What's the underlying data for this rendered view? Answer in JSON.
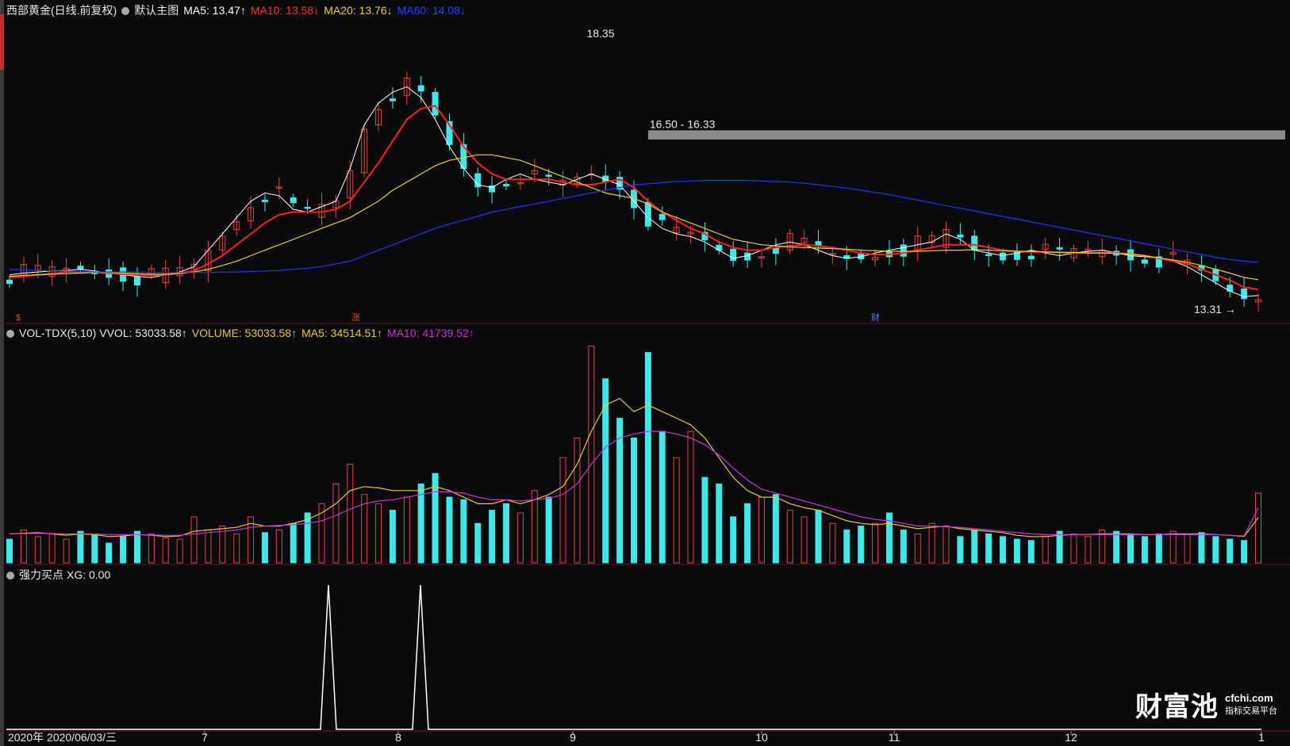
{
  "main_panel": {
    "stock": "西部黄金(日线.前复权)",
    "template": "默认主图",
    "ma5": "MA5: 13.47↑",
    "ma10": "MA10: 13.58↓",
    "ma20": "MA20: 13.76↓",
    "ma60": "MA60: 14.08↓",
    "high_label": "18.35",
    "zone_label": "16.50 - 16.33",
    "low_label": "13.31",
    "markers": [
      "$",
      "涨",
      "财"
    ]
  },
  "volume_panel": {
    "name": "VOL-TDX(5,10)",
    "vvol": "VVOL: 53033.58↑",
    "volume": "VOLUME: 53033.58↑",
    "ma5": "MA5: 34514.51↑",
    "ma10": "MA10: 41739.52↑"
  },
  "signal_panel": {
    "name": "强力买点",
    "xg": "XG: 0.00"
  },
  "footer": {
    "start": "2020年 2020/06/03/三",
    "months": [
      "7",
      "8",
      "9",
      "10",
      "11",
      "12",
      "1"
    ]
  },
  "logo": {
    "main": "财富池",
    "url": "cfchi.com",
    "tagline": "指标交易平台"
  },
  "colors": {
    "up": "#e0463c",
    "down": "#3ee8e8",
    "ma5": "#ffffff",
    "ma10": "#ff2020",
    "ma20": "#e8d030",
    "ma60": "#2233ee",
    "vol_ma5": "#e8c830",
    "vol_ma10": "#cc33cc",
    "signal": "#ffffff",
    "zone": "#8a8a8a"
  },
  "chart_data": [
    {
      "type": "candlestick",
      "title": "西部黄金(日线.前复权)",
      "x_range": [
        "2020-06-03",
        "2021-01"
      ],
      "ylim": [
        13.0,
        18.6
      ],
      "key_prices": {
        "high": 18.35,
        "low": 13.31,
        "zone": [
          16.33,
          16.5
        ]
      },
      "series": [
        {
          "name": "MA5",
          "values": [
            13.85,
            13.88,
            13.9,
            13.92,
            13.93,
            13.95,
            13.92,
            13.88,
            13.85,
            13.82,
            13.8,
            13.85,
            13.9,
            14.0,
            14.3,
            14.6,
            14.9,
            15.2,
            15.35,
            15.3,
            15.05,
            15.0,
            15.1,
            15.2,
            15.8,
            16.6,
            17.0,
            17.2,
            17.3,
            17.1,
            16.7,
            16.2,
            15.8,
            15.5,
            15.45,
            15.6,
            15.7,
            15.6,
            15.55,
            15.5,
            15.6,
            15.7,
            15.6,
            15.5,
            15.2,
            14.9,
            14.7,
            14.6,
            14.55,
            14.45,
            14.3,
            14.15,
            14.2,
            14.3,
            14.4,
            14.45,
            14.4,
            14.3,
            14.2,
            14.15,
            14.18,
            14.25,
            14.3,
            14.35,
            14.4,
            14.45,
            14.6,
            14.5,
            14.3,
            14.25,
            14.2,
            14.25,
            14.3,
            14.25,
            14.2,
            14.25,
            14.28,
            14.3,
            14.25,
            14.2,
            14.18,
            14.15,
            14.1,
            14.0,
            13.85,
            13.7,
            13.55,
            13.45,
            13.47
          ]
        },
        {
          "name": "MA10",
          "values": [
            13.8,
            13.82,
            13.85,
            13.87,
            13.9,
            13.9,
            13.9,
            13.88,
            13.86,
            13.85,
            13.84,
            13.85,
            13.88,
            13.92,
            14.05,
            14.2,
            14.4,
            14.6,
            14.8,
            14.95,
            15.0,
            15.0,
            15.0,
            15.05,
            15.2,
            15.55,
            15.9,
            16.3,
            16.7,
            16.9,
            16.95,
            16.6,
            16.2,
            15.9,
            15.7,
            15.6,
            15.6,
            15.6,
            15.6,
            15.55,
            15.5,
            15.5,
            15.55,
            15.6,
            15.45,
            15.2,
            15.0,
            14.85,
            14.7,
            14.6,
            14.45,
            14.35,
            14.3,
            14.3,
            14.35,
            14.38,
            14.4,
            14.38,
            14.35,
            14.3,
            14.25,
            14.22,
            14.22,
            14.25,
            14.3,
            14.35,
            14.4,
            14.4,
            14.4,
            14.35,
            14.3,
            14.28,
            14.27,
            14.27,
            14.26,
            14.25,
            14.25,
            14.25,
            14.25,
            14.23,
            14.2,
            14.15,
            14.1,
            14.05,
            13.95,
            13.85,
            13.75,
            13.62,
            13.58
          ]
        },
        {
          "name": "MA20",
          "values": [
            13.82,
            13.84,
            13.85,
            13.86,
            13.87,
            13.88,
            13.89,
            13.89,
            13.88,
            13.87,
            13.86,
            13.86,
            13.87,
            13.9,
            13.95,
            14.02,
            14.1,
            14.2,
            14.3,
            14.4,
            14.5,
            14.6,
            14.7,
            14.8,
            14.9,
            15.05,
            15.2,
            15.4,
            15.55,
            15.7,
            15.85,
            15.95,
            16.0,
            16.05,
            16.05,
            16.0,
            15.95,
            15.85,
            15.75,
            15.65,
            15.55,
            15.45,
            15.35,
            15.3,
            15.25,
            15.15,
            15.0,
            14.9,
            14.8,
            14.7,
            14.6,
            14.5,
            14.45,
            14.4,
            14.38,
            14.36,
            14.35,
            14.34,
            14.33,
            14.32,
            14.3,
            14.29,
            14.28,
            14.28,
            14.28,
            14.29,
            14.3,
            14.3,
            14.31,
            14.3,
            14.29,
            14.28,
            14.28,
            14.27,
            14.26,
            14.26,
            14.25,
            14.25,
            14.24,
            14.23,
            14.2,
            14.16,
            14.12,
            14.08,
            14.02,
            13.95,
            13.88,
            13.8,
            13.76
          ]
        },
        {
          "name": "MA60",
          "values": [
            13.95,
            13.94,
            13.93,
            13.92,
            13.92,
            13.91,
            13.9,
            13.9,
            13.9,
            13.9,
            13.89,
            13.89,
            13.89,
            13.89,
            13.89,
            13.9,
            13.9,
            13.91,
            13.92,
            13.93,
            13.95,
            13.97,
            14.0,
            14.05,
            14.1,
            14.2,
            14.3,
            14.4,
            14.5,
            14.6,
            14.7,
            14.78,
            14.85,
            14.92,
            15.0,
            15.05,
            15.1,
            15.15,
            15.2,
            15.25,
            15.3,
            15.35,
            15.4,
            15.45,
            15.5,
            15.52,
            15.54,
            15.56,
            15.57,
            15.58,
            15.58,
            15.58,
            15.58,
            15.57,
            15.56,
            15.55,
            15.53,
            15.5,
            15.47,
            15.44,
            15.4,
            15.36,
            15.32,
            15.27,
            15.22,
            15.17,
            15.12,
            15.07,
            15.02,
            14.97,
            14.92,
            14.87,
            14.82,
            14.77,
            14.72,
            14.67,
            14.62,
            14.57,
            14.52,
            14.47,
            14.42,
            14.37,
            14.32,
            14.27,
            14.22,
            14.17,
            14.13,
            14.1,
            14.08
          ]
        }
      ]
    },
    {
      "type": "bar",
      "title": "VOL-TDX(5,10)",
      "ylim": [
        0,
        170000
      ],
      "last": {
        "volume": 53033.58,
        "ma5": 34514.51,
        "ma10": 41739.52
      },
      "values": [
        18000,
        25000,
        20000,
        22000,
        18000,
        24000,
        21000,
        15000,
        20000,
        24000,
        22000,
        19000,
        18000,
        35000,
        25000,
        28000,
        22000,
        35000,
        23000,
        25000,
        30000,
        38000,
        45000,
        60000,
        75000,
        52000,
        45000,
        40000,
        50000,
        60000,
        68000,
        50000,
        48000,
        30000,
        40000,
        45000,
        38000,
        55000,
        50000,
        80000,
        95000,
        165000,
        140000,
        110000,
        95000,
        160000,
        100000,
        80000,
        100000,
        65000,
        60000,
        35000,
        45000,
        50000,
        52000,
        40000,
        35000,
        40000,
        30000,
        25000,
        28000,
        30000,
        38000,
        25000,
        22000,
        30000,
        28000,
        20000,
        25000,
        22000,
        20000,
        18000,
        17000,
        20000,
        24000,
        22000,
        20000,
        25000,
        24000,
        21000,
        20000,
        22000,
        24000,
        22000,
        23000,
        20000,
        18000,
        17000,
        53034
      ],
      "series": [
        {
          "name": "MA5",
          "values": [
            22000,
            22500,
            23000,
            22000,
            21000,
            22000,
            21500,
            20000,
            20500,
            21500,
            21000,
            20000,
            20500,
            24000,
            25000,
            26000,
            27000,
            30000,
            28000,
            28000,
            30000,
            33000,
            38000,
            45000,
            55000,
            58000,
            57000,
            55000,
            55000,
            55000,
            58000,
            55000,
            50000,
            45000,
            45000,
            48000,
            45000,
            48000,
            52000,
            58000,
            75000,
            100000,
            120000,
            125000,
            115000,
            120000,
            115000,
            110000,
            105000,
            95000,
            80000,
            65000,
            55000,
            50000,
            50000,
            45000,
            42000,
            40000,
            36000,
            32000,
            30000,
            29000,
            30000,
            28000,
            26000,
            27000,
            28000,
            26000,
            25000,
            24000,
            23000,
            21000,
            20000,
            20000,
            21000,
            21500,
            21500,
            22000,
            22000,
            22000,
            21500,
            21500,
            22000,
            22000,
            22000,
            21500,
            21000,
            20000,
            34515
          ]
        },
        {
          "name": "MA10",
          "values": [
            22000,
            22200,
            22400,
            22300,
            22000,
            22200,
            22000,
            21500,
            21500,
            21500,
            21300,
            21000,
            21000,
            22000,
            23000,
            24000,
            25000,
            27000,
            28000,
            28500,
            29000,
            30000,
            32000,
            36000,
            41000,
            45000,
            47000,
            48000,
            50000,
            52000,
            54000,
            54000,
            53000,
            50000,
            48000,
            48000,
            47000,
            48000,
            49000,
            52000,
            60000,
            75000,
            88000,
            95000,
            98000,
            100000,
            100000,
            98000,
            95000,
            90000,
            82000,
            72000,
            63000,
            56000,
            53000,
            50000,
            47000,
            44000,
            41000,
            38000,
            35000,
            33000,
            32000,
            30000,
            28000,
            28000,
            27500,
            27000,
            26000,
            25000,
            24000,
            23000,
            22000,
            21500,
            21500,
            21500,
            21500,
            21500,
            21500,
            21500,
            21500,
            21500,
            21500,
            21500,
            21500,
            21500,
            21000,
            20500,
            41740
          ]
        }
      ]
    },
    {
      "type": "line",
      "title": "强力买点",
      "ylim": [
        0,
        1
      ],
      "signals_at_month_fraction": [
        "7月末",
        "8月中"
      ],
      "values_note": "two spikes reaching 1, otherwise 0"
    }
  ]
}
